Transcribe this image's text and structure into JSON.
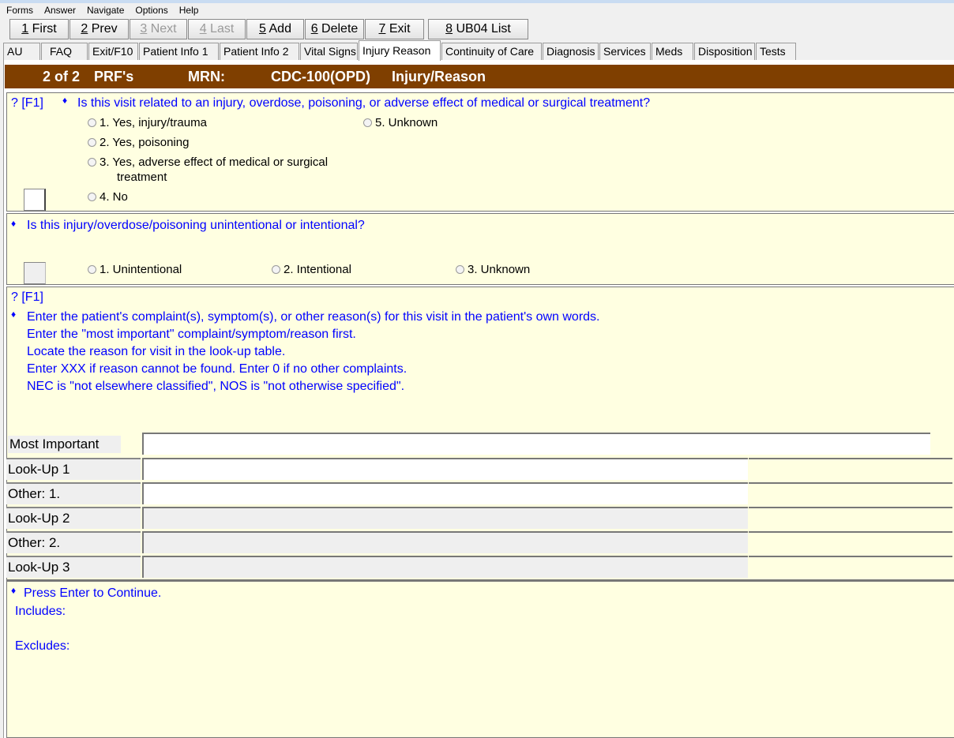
{
  "menu": [
    "Forms",
    "Answer",
    "Navigate",
    "Options",
    "Help"
  ],
  "toolbar": [
    {
      "key": "1",
      "label": " First",
      "enabled": true
    },
    {
      "key": "2",
      "label": " Prev",
      "enabled": true
    },
    {
      "key": "3",
      "label": " Next",
      "enabled": false
    },
    {
      "key": "4",
      "label": " Last",
      "enabled": false
    },
    {
      "key": "5",
      "label": " Add",
      "enabled": true
    },
    {
      "key": "6",
      "label": " Delete",
      "enabled": true
    },
    {
      "key": "7",
      "label": " Exit",
      "enabled": true
    },
    {
      "key": "8",
      "label": " UB04 List",
      "enabled": true
    }
  ],
  "tabs": [
    "AU",
    "FAQ",
    "Exit/F10",
    "Patient Info 1",
    "Patient Info 2",
    "Vital Signs",
    "Injury Reason",
    "Continuity of Care",
    "Diagnosis",
    "Services",
    "Meds",
    "Disposition",
    "Tests"
  ],
  "active_tab": "Injury Reason",
  "header": {
    "count": "2 of 2",
    "prfs": "PRF's",
    "mrn_label": "MRN:",
    "mrn": "CDC-100(OPD)",
    "section": "Injury/Reason"
  },
  "q1": {
    "help": "? [F1]",
    "bullet": "♦",
    "text": "Is this visit related to an injury, overdose, poisoning, or adverse effect of medical or surgical treatment?",
    "options": [
      "1. Yes, injury/trauma",
      "2. Yes, poisoning",
      "3. Yes, adverse effect of medical or surgical",
      "4. No",
      "5. Unknown"
    ],
    "option3_cont": "treatment",
    "value": ""
  },
  "q2": {
    "bullet": "♦",
    "text": "Is this injury/overdose/poisoning unintentional or intentional?",
    "options": [
      "1. Unintentional",
      "2. Intentional",
      "3. Unknown"
    ],
    "value": ""
  },
  "q3": {
    "help": "? [F1]",
    "bullet": "♦",
    "lines": [
      "Enter the patient's complaint(s), symptom(s), or other reason(s) for this visit in the patient's own words.",
      "Enter the \"most important\" complaint/symptom/reason first.",
      "Locate the reason for visit in the look-up table.",
      "Enter XXX if reason cannot be found. Enter 0 if no other complaints.",
      "NEC is \"not elsewhere classified\", NOS is \"not otherwise specified\"."
    ]
  },
  "fields": {
    "most_important": "Most Important",
    "rows": [
      "Look-Up 1",
      "Other: 1.",
      "Look-Up 2",
      "Other: 2.",
      "Look-Up 3"
    ]
  },
  "footer": {
    "bullet": "♦",
    "press": "Press Enter to Continue.",
    "includes": "Includes:",
    "excludes": "Excludes:"
  },
  "colors": {
    "header": "#7f3f00",
    "panel": "#ffffe1",
    "prompt": "#0000ff"
  }
}
